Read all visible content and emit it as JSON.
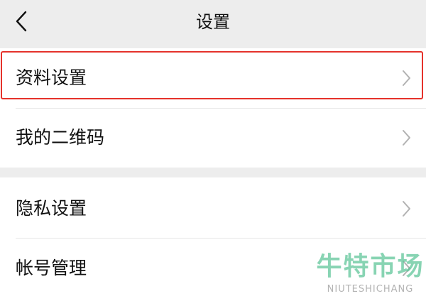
{
  "header": {
    "back_icon": "chevron-left-icon",
    "title": "设置"
  },
  "groups": [
    {
      "items": [
        {
          "label": "资料设置",
          "icon": "chevron-right-icon",
          "highlighted": true
        },
        {
          "label": "我的二维码",
          "icon": "chevron-right-icon"
        }
      ]
    },
    {
      "items": [
        {
          "label": "隐私设置",
          "icon": "chevron-right-icon"
        },
        {
          "label": "帐号管理",
          "icon": "chevron-right-icon"
        }
      ]
    }
  ],
  "watermark": {
    "logo_text": "牛特市场",
    "sub_text": "NIUTESHICHANG"
  },
  "colors": {
    "background": "#ededed",
    "row_background": "#ffffff",
    "highlight_border": "#e5322b",
    "watermark": "#5ac496",
    "chevron": "#b2b2b2"
  }
}
